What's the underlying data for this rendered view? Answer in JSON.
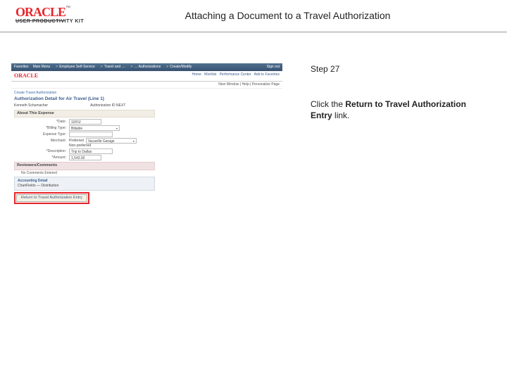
{
  "brand": {
    "name": "ORACLE",
    "tm": "™",
    "sub": "USER PRODUCTIVITY KIT"
  },
  "page_title": "Attaching a Document to a Travel Authorization",
  "instruction": {
    "step_label": "Step 27",
    "prefix": "Click the ",
    "bold": "Return to Travel Authorization Entry",
    "suffix": " link."
  },
  "mock": {
    "nav": {
      "i1": "Favorites",
      "i2": "Main Menu",
      "i3": "Employee Self-Service",
      "i4": "Travel and …",
      "i5": "… Authorizations",
      "i6": "Create/Modify",
      "signout": "Sign out"
    },
    "brandbar": {
      "logo": "ORACLE",
      "tabs": {
        "home": "Home",
        "worklist": "Worklist",
        "perf": "Performance Center",
        "add": "Add to Favorites"
      }
    },
    "subbar": "New Window | Help | Personalize Page",
    "crumb": "Create Travel Authorization",
    "h1": "Authorization Detail for Air Travel (Line 1)",
    "row2": {
      "a": "Kenneth Schumacher",
      "b": "Authorization ID NEXT"
    },
    "section_about": "About This Expense",
    "form": {
      "date": {
        "label": "*Date:",
        "value": "10/01/"
      },
      "billing": {
        "label": "*Billing Type:",
        "value": "Billable"
      },
      "expense": {
        "label": "Expense Type:",
        "sep": " "
      },
      "merchant": {
        "label": "Merchant:",
        "opt": "Preferred",
        "value": "Vacaville Garage"
      },
      "nonpref": "Non-preferred",
      "desc": {
        "label": "*Description:",
        "value": "Trip to Dallas"
      },
      "amount": {
        "label": "*Amount:",
        "value": "1,543.00"
      }
    },
    "section_comments": "Reviewers/Comments",
    "nocomments": "No Comments Entered",
    "accounting": {
      "head": "Accounting Detail",
      "line": "ChartFields — Distribution"
    },
    "return_link": "Return to Travel Authorization Entry"
  }
}
